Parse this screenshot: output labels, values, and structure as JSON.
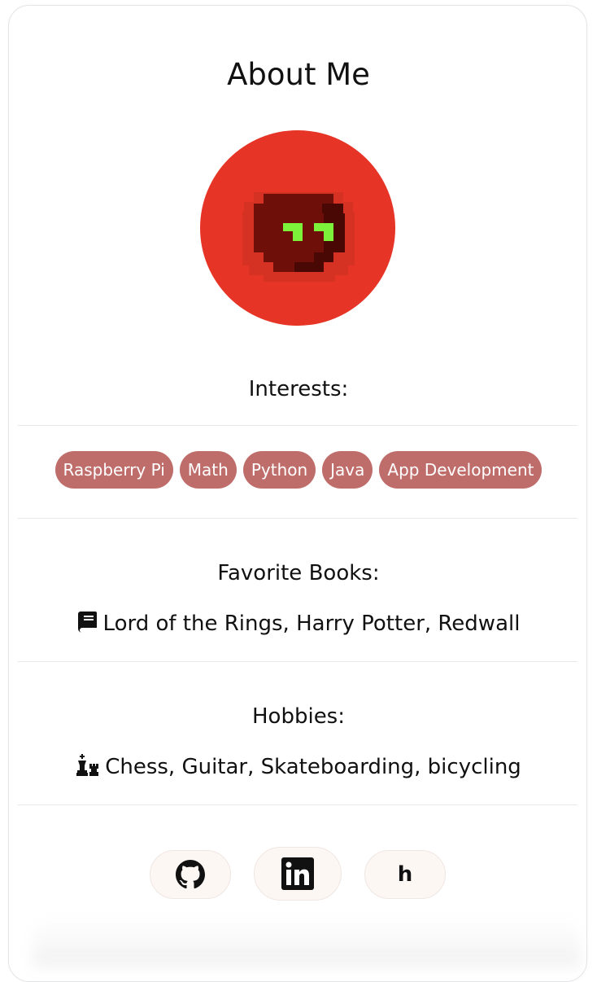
{
  "page": {
    "title": "About Me"
  },
  "avatar": {
    "background_color": "#e63426",
    "icon": "pixel-art-character-icon"
  },
  "interests": {
    "heading": "Interests:",
    "chip_color": "#bf6d6b",
    "items": [
      "Raspberry Pi",
      "Math",
      "Python",
      "Java",
      "App Development"
    ]
  },
  "books": {
    "heading": "Favorite Books:",
    "icon": "book-icon",
    "text": "Lord of the Rings, Harry Potter, Redwall"
  },
  "hobbies": {
    "heading": "Hobbies:",
    "icon": "chess-pieces-icon",
    "text": "Chess, Guitar, Skateboarding, bicycling"
  },
  "social": {
    "links": [
      {
        "icon": "github-icon"
      },
      {
        "icon": "linkedin-icon"
      },
      {
        "icon": "h-icon",
        "label": "h"
      }
    ]
  }
}
